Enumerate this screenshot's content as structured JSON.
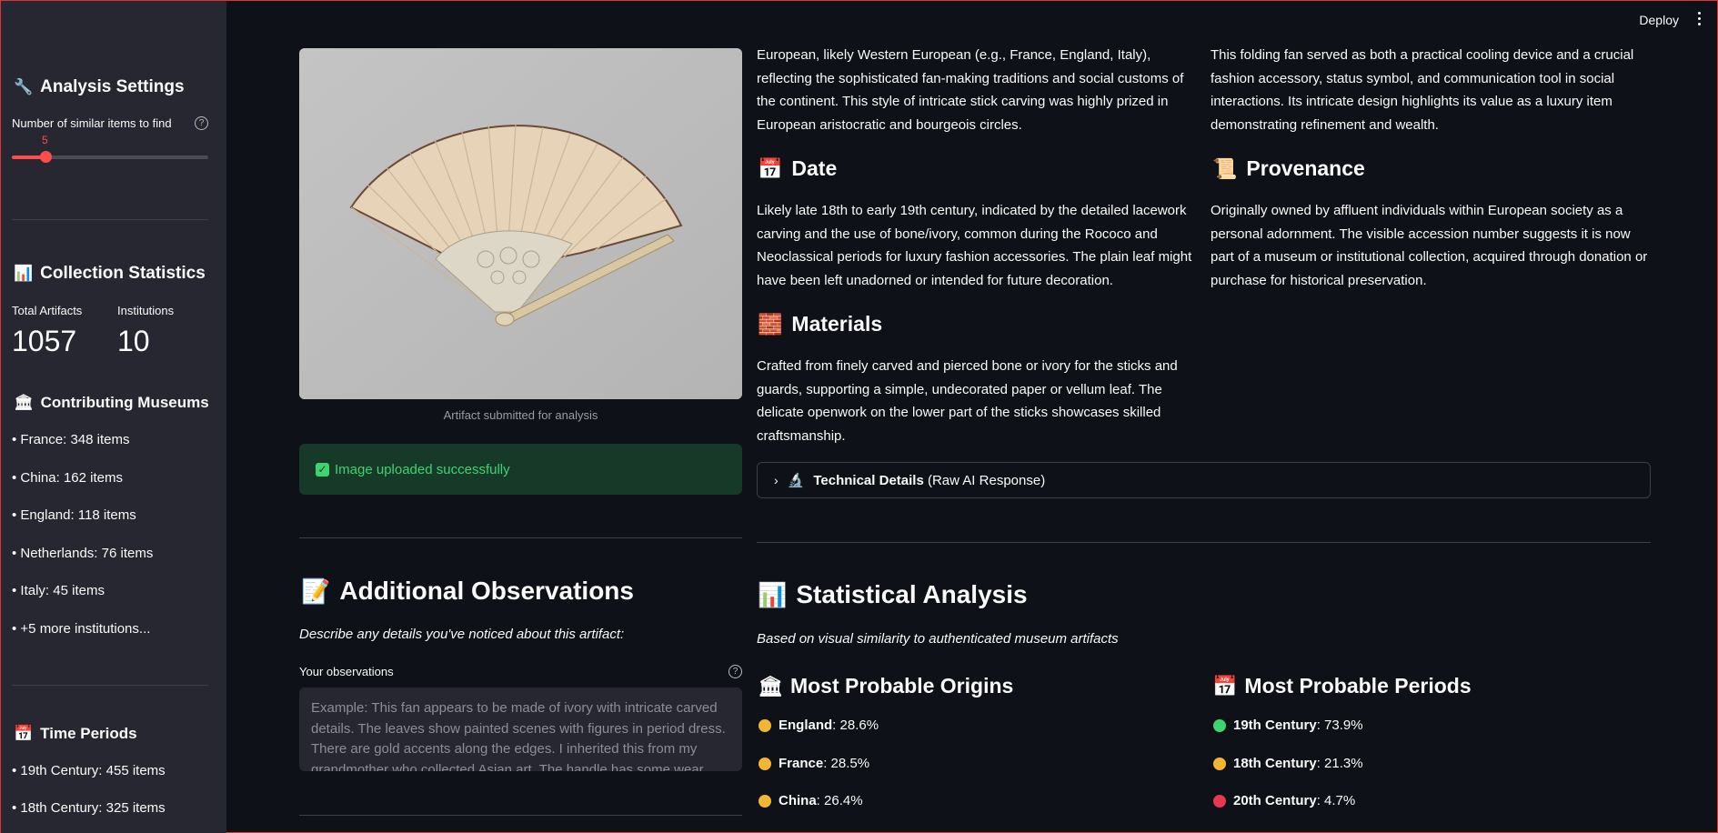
{
  "sidebar": {
    "analysis_title": "Analysis Settings",
    "slider_label": "Number of similar items to find",
    "slider_value": "5",
    "slider_fraction": 0.17,
    "collection_title": "Collection Statistics",
    "metrics": [
      {
        "label": "Total Artifacts",
        "value": "1057"
      },
      {
        "label": "Institutions",
        "value": "10"
      }
    ],
    "museums_title": "Contributing Museums",
    "museums": [
      "• France: 348 items",
      "• China: 162 items",
      "• England: 118 items",
      "• Netherlands: 76 items",
      "• Italy: 45 items",
      "• +5 more institutions..."
    ],
    "periods_title": "Time Periods",
    "periods": [
      "• 19th Century: 455 items",
      "• 18th Century: 325 items"
    ]
  },
  "header": {
    "deploy": "Deploy"
  },
  "image": {
    "caption": "Artifact submitted for analysis",
    "success": "Image uploaded successfully"
  },
  "analysis": {
    "origin_text": "European, likely Western European (e.g., France, England, Italy), reflecting the sophisticated fan-making traditions and social customs of the continent. This style of intricate stick carving was highly prized in European aristocratic and bourgeois circles.",
    "function_text": "This folding fan served as both a practical cooling device and a crucial fashion accessory, status symbol, and communication tool in social interactions. Its intricate design highlights its value as a luxury item demonstrating refinement and wealth.",
    "date_title": "Date",
    "date_text": "Likely late 18th to early 19th century, indicated by the detailed lacework carving and the use of bone/ivory, common during the Rococo and Neoclassical periods for luxury fashion accessories. The plain leaf might have been left unadorned or intended for future decoration.",
    "provenance_title": "Provenance",
    "provenance_text": "Originally owned by affluent individuals within European society as a personal adornment. The visible accession number suggests it is now part of a museum or institutional collection, acquired through donation or purchase for historical preservation.",
    "materials_title": "Materials",
    "materials_text": "Crafted from finely carved and pierced bone or ivory for the sticks and guards, supporting a simple, undecorated paper or vellum leaf. The delicate openwork on the lower part of the sticks showcases skilled craftsmanship.",
    "tech_bold": "Technical Details",
    "tech_rest": " (Raw AI Response)"
  },
  "observations": {
    "title": "Additional Observations",
    "subtitle": "Describe any details you've noticed about this artifact:",
    "label": "Your observations",
    "placeholder": "Example: This fan appears to be made of ivory with intricate carved details. The leaves show painted scenes with figures in period dress. There are gold accents along the edges. I inherited this from my grandmother who collected Asian art. The handle has some wear"
  },
  "statistics": {
    "title": "Statistical Analysis",
    "subtitle": "Based on visual similarity to authenticated museum artifacts",
    "origins_title": "Most Probable Origins",
    "origins": [
      {
        "name": "England",
        "pct": ": 28.6%",
        "color": "#f2b632"
      },
      {
        "name": "France",
        "pct": ": 28.5%",
        "color": "#f2b632"
      },
      {
        "name": "China",
        "pct": ": 26.4%",
        "color": "#f2b632"
      }
    ],
    "periods_title": "Most Probable Periods",
    "periods": [
      {
        "name": "19th Century",
        "pct": ": 73.9%",
        "color": "#3dd56d"
      },
      {
        "name": "18th Century",
        "pct": ": 21.3%",
        "color": "#f2b632"
      },
      {
        "name": "20th Century",
        "pct": ": 4.7%",
        "color": "#e8384f"
      }
    ]
  },
  "icons": {
    "wrench": "wrench-icon",
    "chart": "bar-chart-icon",
    "museum": "classical-building-icon",
    "calendar": "calendar-icon",
    "scroll": "scroll-icon",
    "bricks": "bricks-icon",
    "microscope": "microscope-icon",
    "memo": "memo-icon"
  }
}
